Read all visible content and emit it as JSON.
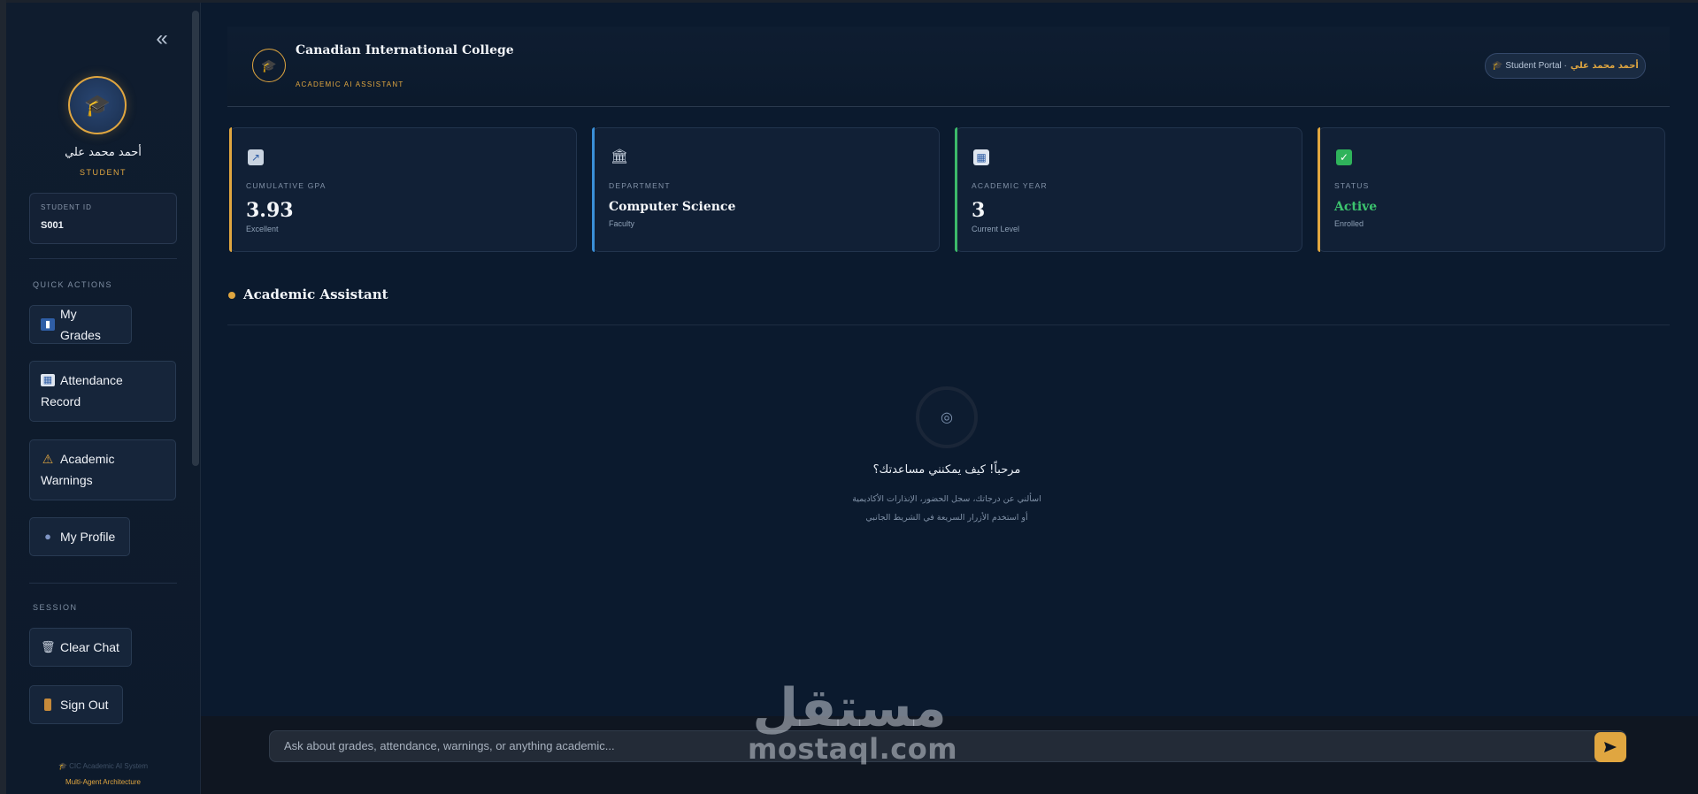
{
  "sidebar": {
    "collapse_glyph": "«",
    "user_name": "أحمد محمد علي",
    "user_role": "STUDENT",
    "student_id_label": "STUDENT ID",
    "student_id_value": "S001",
    "quick_actions_label": "QUICK ACTIONS",
    "buttons": [
      {
        "label": "My Grades",
        "icon": "bar-chart-icon"
      },
      {
        "label": "Attendance Record",
        "line1": "Attendance",
        "line2": "Record",
        "icon": "calendar-icon"
      },
      {
        "label": "Academic Warnings",
        "line1": "Academic",
        "line2": "Warnings",
        "icon": "warning-icon"
      },
      {
        "label": "My Profile",
        "icon": "user-silhouette-icon"
      }
    ],
    "session_label": "SESSION",
    "session_buttons": [
      {
        "label": "Clear Chat",
        "icon": "wastebasket-icon"
      },
      {
        "label": "Sign Out",
        "icon": "door-icon"
      }
    ],
    "footer_line1": "🎓 CIC Academic AI System",
    "footer_line2": "Multi-Agent Architecture"
  },
  "header": {
    "college_name": "Canadian International College",
    "subtitle": "ACADEMIC AI ASSISTANT",
    "portal_label": "🎓 Student Portal ·",
    "portal_user": "أحمد محمد علي"
  },
  "cards": [
    {
      "label": "CUMULATIVE GPA",
      "value": "3.93",
      "sub": "Excellent",
      "icon": "chart-line-icon",
      "accent": "#e0a640"
    },
    {
      "label": "DEPARTMENT",
      "value": "Computer Science",
      "sub": "Faculty",
      "icon": "building-icon",
      "accent": "#3a8fd8"
    },
    {
      "label": "ACADEMIC YEAR",
      "value": "3",
      "sub": "Current Level",
      "icon": "calendar-icon",
      "accent": "#3cba6a"
    },
    {
      "label": "STATUS",
      "value": "Active",
      "sub": "Enrolled",
      "icon": "check-icon",
      "accent": "#e0a640"
    }
  ],
  "chat": {
    "section_title": "Academic Assistant",
    "welcome_title": "مرحباً! كيف يمكنني مساعدتك؟",
    "welcome_sub1": "اسألني عن درجاتك، سجل الحضور، الإنذارات الأكاديمية",
    "welcome_sub2": "أو استخدم الأزرار السريعة في الشريط الجانبي",
    "input_placeholder": "Ask about grades, attendance, warnings, or anything academic..."
  },
  "watermark": {
    "arabic": "مستقل",
    "latin": "mostaql.com"
  },
  "colors": {
    "accent": "#e0a640",
    "background": "#0b1a2e",
    "status_active": "#3cc46e"
  }
}
